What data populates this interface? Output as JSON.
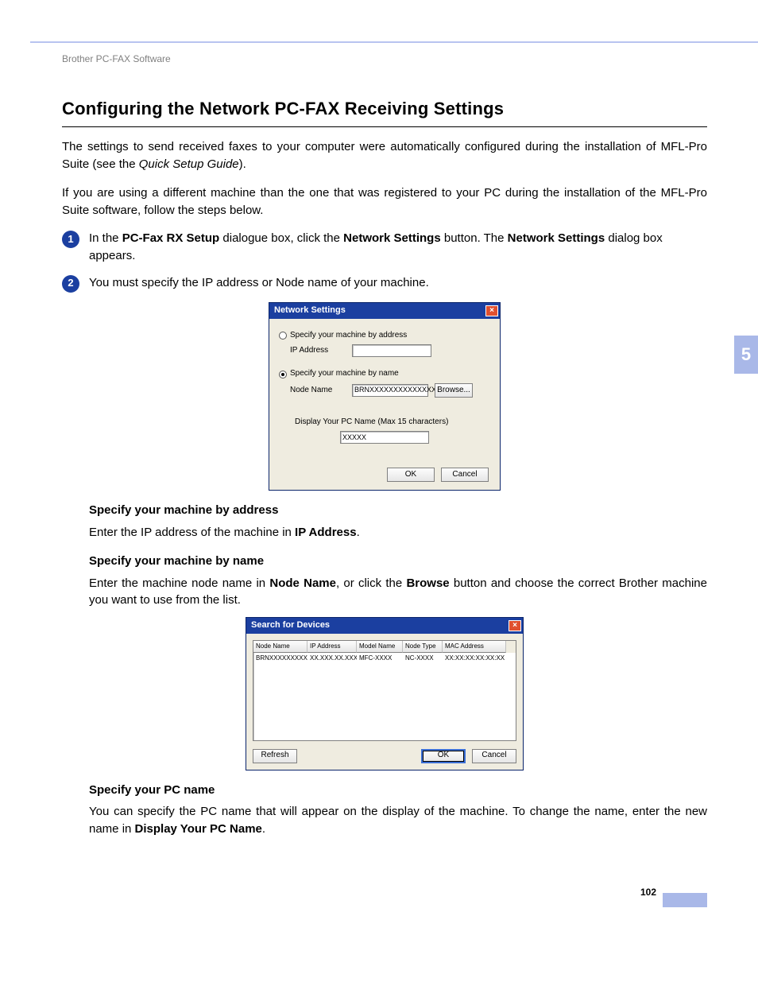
{
  "running_head": "Brother PC-FAX Software",
  "title": "Configuring the Network PC-FAX Receiving Settings",
  "intro1_a": "The settings to send received faxes to your computer were automatically configured during the installation of MFL-Pro Suite (see the ",
  "intro1_em": "Quick Setup Guide",
  "intro1_b": ").",
  "intro2": "If you are using a different machine than the one that was registered to your PC during the installation of the MFL-Pro Suite software, follow the steps below.",
  "step1": {
    "num": "1",
    "a": "In the ",
    "b1": "PC-Fax RX Setup",
    "b": " dialogue box, click the ",
    "b2": "Network Settings",
    "c": " button. The ",
    "b3": "Network Settings",
    "d": " dialog box appears."
  },
  "step2": {
    "num": "2",
    "text": "You must specify the IP address or Node name of your machine."
  },
  "dlg1": {
    "title": "Network Settings",
    "radio_addr": "Specify your machine by address",
    "ip_label": "IP Address",
    "ip_value": "",
    "radio_name": "Specify your machine by name",
    "node_label": "Node Name",
    "node_value": "BRNXXXXXXXXXXXXXX",
    "browse": "Browse...",
    "pcname_caption": "Display Your PC Name (Max 15 characters)",
    "pcname_value": "XXXXX",
    "ok": "OK",
    "cancel": "Cancel"
  },
  "sec_addr_head": "Specify your machine by address",
  "sec_addr_body_a": "Enter the IP address of the machine in ",
  "sec_addr_body_b": "IP Address",
  "sec_addr_body_c": ".",
  "sec_name_head": "Specify your machine by name",
  "sec_name_body_a": "Enter the machine node name in ",
  "sec_name_body_b": "Node Name",
  "sec_name_body_c": ", or click the ",
  "sec_name_body_d": "Browse",
  "sec_name_body_e": " button and choose the correct Brother machine you want to use from the list.",
  "dlg2": {
    "title": "Search for Devices",
    "cols": [
      "Node Name",
      "IP Address",
      "Model Name",
      "Node Type",
      "MAC Address"
    ],
    "row": [
      "BRNXXXXXXXXXX",
      "XX.XXX.XX.XXX",
      "MFC-XXXX",
      "NC-XXXX",
      "XX:XX:XX:XX:XX:XX"
    ],
    "refresh": "Refresh",
    "ok": "OK",
    "cancel": "Cancel"
  },
  "sec_pc_head": "Specify your PC name",
  "sec_pc_body_a": "You can specify the PC name that will appear on the display of the machine. To change the name, enter the new name in ",
  "sec_pc_body_b": "Display Your PC Name",
  "sec_pc_body_c": ".",
  "side_tab": "5",
  "page_num": "102"
}
